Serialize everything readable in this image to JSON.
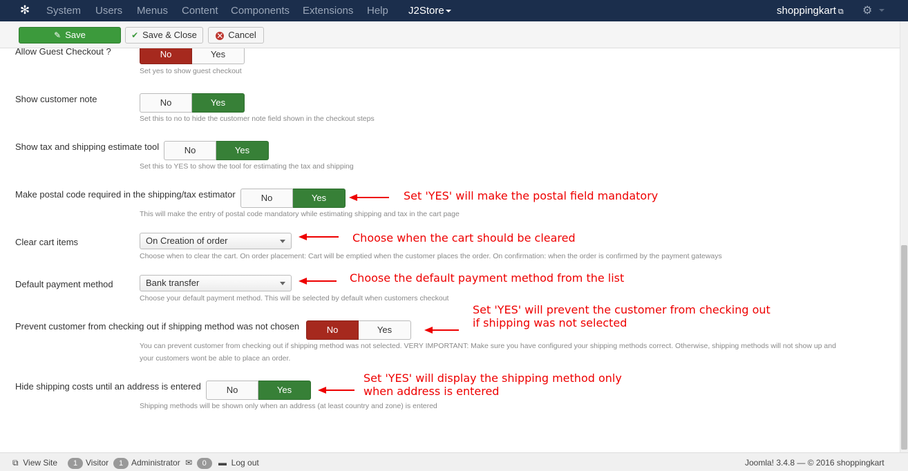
{
  "navbar": {
    "menu": [
      "System",
      "Users",
      "Menus",
      "Content",
      "Components",
      "Extensions",
      "Help"
    ],
    "active_menu": "J2Store",
    "site_name": "shoppingkart"
  },
  "toolbar": {
    "save_label": "Save",
    "save_close_label": "Save & Close",
    "cancel_label": "Cancel"
  },
  "toggle_labels": {
    "no": "No",
    "yes": "Yes"
  },
  "settings": [
    {
      "label": "Allow Guest Checkout ?",
      "value": "No",
      "help": "Set yes to show guest checkout"
    },
    {
      "label": "Show customer note",
      "value": "Yes",
      "help": "Set this to no to hide the customer note field shown in the checkout steps"
    },
    {
      "label": "Show tax and shipping estimate tool",
      "value": "Yes",
      "help": "Set this to YES to show the tool for estimating the tax and shipping"
    },
    {
      "label": "Make postal code required in the shipping/tax estimator",
      "value": "Yes",
      "help": "This will make the entry of postal code mandatory while estimating shipping and tax in the cart page"
    },
    {
      "label": "Clear cart items",
      "value": "On Creation of order",
      "help": "Choose when to clear the cart. On order placement: Cart will be emptied when the customer places the order. On confirmation: when the order is confirmed by the payment gateways"
    },
    {
      "label": "Default payment method",
      "value": "Bank transfer",
      "help": "Choose your default payment method. This will be selected by default when customers checkout"
    },
    {
      "label": "Prevent customer from checking out if shipping method was not chosen",
      "value": "No",
      "help_line1": "You can prevent customer from checking out if shipping method was not selected. VERY IMPORTANT: Make sure you have configured your shipping methods correct. Otherwise, shipping methods will not show up and",
      "help_line2": "your customers wont be able to place an order."
    },
    {
      "label": "Hide shipping costs until an address is entered",
      "value": "Yes",
      "help": "Shipping methods will be shown only when an address (at least country and zone) is entered"
    }
  ],
  "annotations": {
    "postal": "Set 'YES' will make the postal field mandatory",
    "clear_cart": "Choose when the cart should be cleared",
    "payment": "Choose the default payment method from the list",
    "prevent_line1": "Set 'YES' will prevent the customer from checking out",
    "prevent_line2": "if shipping was not selected",
    "hide_line1": "Set 'YES' will display the shipping method only",
    "hide_line2": "when address is entered"
  },
  "footer": {
    "view_site": "View Site",
    "visitor_count": "1",
    "visitor_label": "Visitor",
    "admin_count": "1",
    "admin_label": "Administrator",
    "messages_count": "0",
    "logout": "Log out",
    "version": "Joomla! 3.4.8  —  © 2016 shoppingkart"
  },
  "colors": {
    "navbar": "#1b2e4c",
    "active_green": "#378037",
    "active_red": "#a6291e",
    "annotation": "#ee0000"
  }
}
